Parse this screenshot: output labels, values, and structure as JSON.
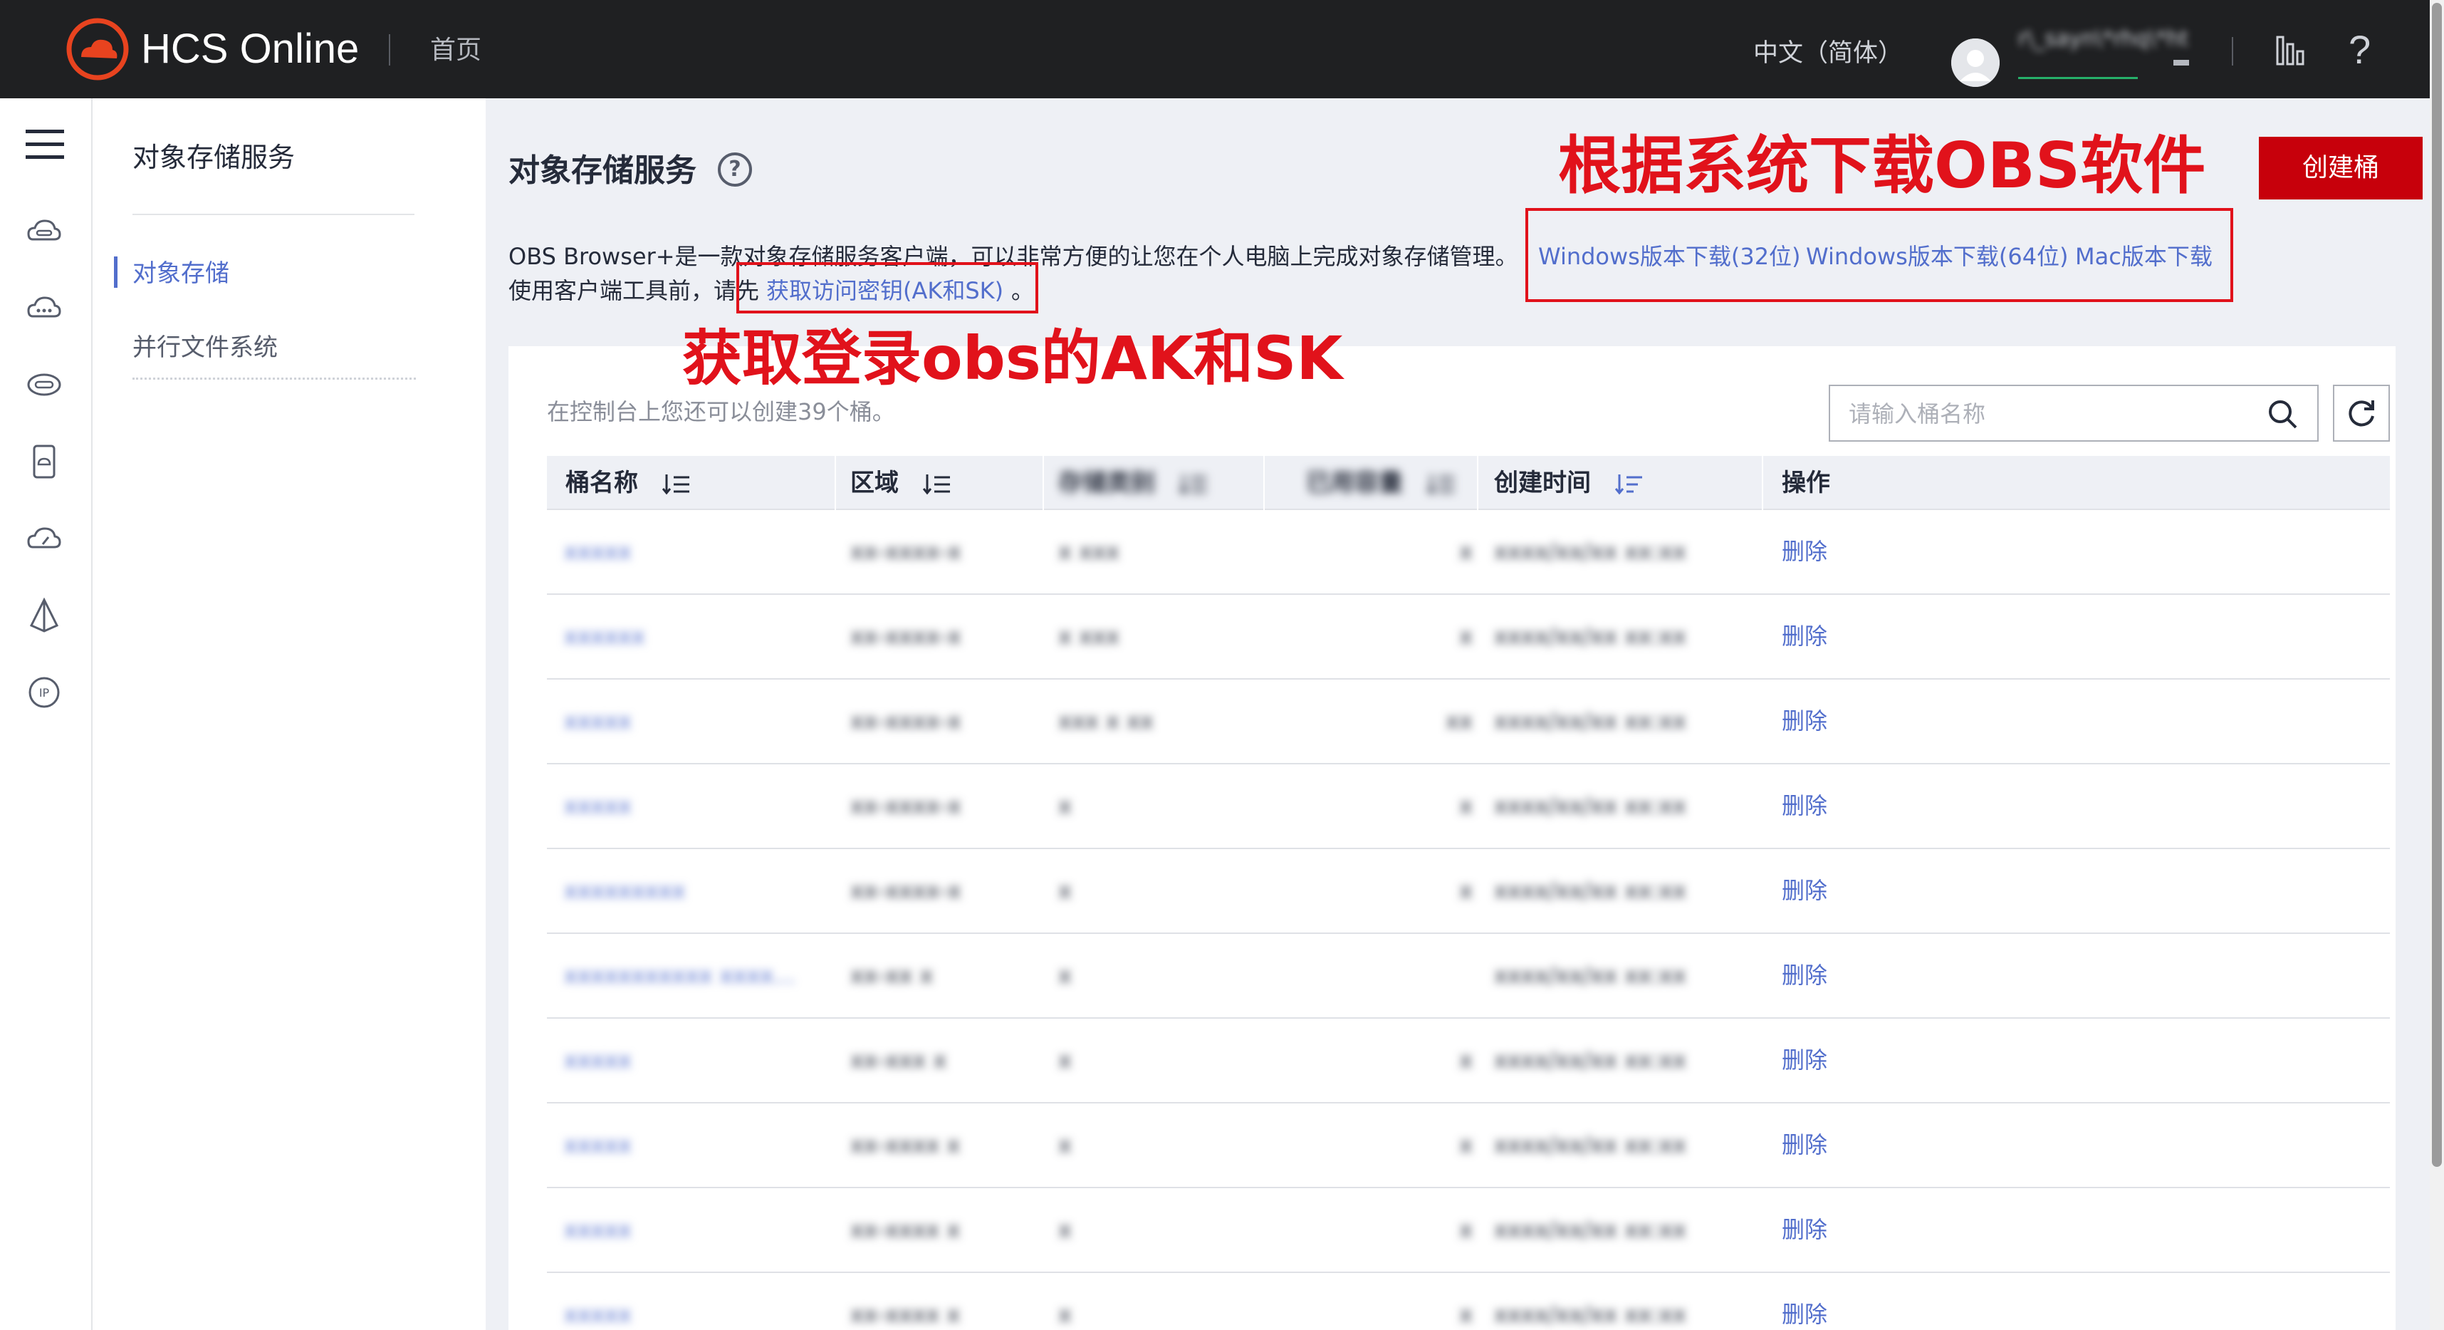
{
  "header": {
    "brand": "HCS Online",
    "home": "首页",
    "language": "中文（简体）",
    "username": "r\\_sayn\\*rhq\\*ht",
    "logo_color": "#e8431f"
  },
  "rail": {
    "icons": [
      "menu-icon",
      "obs-cloud-icon",
      "cloud-chat-icon",
      "storage-icon",
      "device-icon",
      "cloud-speed-icon",
      "pyramid-icon",
      "ip-icon"
    ]
  },
  "sidenav": {
    "title": "对象存储服务",
    "items": [
      {
        "label": "对象存储",
        "active": true
      },
      {
        "label": "并行文件系统",
        "active": false
      }
    ]
  },
  "main": {
    "title": "对象存储服务",
    "create_button": "创建桶",
    "desc_line1": "OBS Browser+是一款对象存储服务客户端，可以非常方便的让您在个人电脑上完成对象存储管理。",
    "desc_line2_prefix": "使用客户端工具前，请先",
    "desc_line2_suffix": "。",
    "links": {
      "win32": "Windows版本下载(32位)",
      "win64": "Windows版本下载(64位)",
      "mac": "Mac版本下载",
      "ak_sk": "获取访问密钥(AK和SK)"
    },
    "quota_text": "在控制台上您还可以创建39个桶。",
    "search_placeholder": "请输入桶名称"
  },
  "annotations": {
    "download": "根据系统下载OBS软件",
    "aksk": "获取登录obs的AK和SK",
    "color": "#e1121b"
  },
  "table": {
    "headers": {
      "name": "桶名称",
      "region": "区域",
      "storage_class": "存储类别",
      "size": "已用容量",
      "created": "创建时间",
      "actions": "操作"
    },
    "rows": [
      {
        "name": "xxxxx",
        "region": "xx-xxxx-x",
        "class": "x xxx",
        "size": "x",
        "created": "xxxx/xx/xx xx:xx",
        "action": "删除"
      },
      {
        "name": "xxxxxx",
        "region": "xx-xxxx-x",
        "class": "x xxx",
        "size": "x",
        "created": "xxxx/xx/xx xx:xx",
        "action": "删除"
      },
      {
        "name": "xxxxx",
        "region": "xx-xxxx-x",
        "class": "xxx x xx",
        "size": "xx",
        "created": "xxxx/xx/xx xx:xx",
        "action": "删除"
      },
      {
        "name": "xxxxx",
        "region": "xx-xxxx-x",
        "class": "x",
        "size": "x",
        "created": "xxxx/xx/xx xx:xx",
        "action": "删除"
      },
      {
        "name": "xxxxxxxxx",
        "region": "xx-xxxx-x",
        "class": "x",
        "size": "x",
        "created": "xxxx/xx/xx xx:xx",
        "action": "删除"
      },
      {
        "name": "xxxxxxxxxxx xxxx...",
        "region": "xx-xx x",
        "class": "x",
        "size": "",
        "created": "xxxx/xx/xx xx:xx",
        "action": "删除"
      },
      {
        "name": "xxxxx",
        "region": "xx-xxx x",
        "class": "x",
        "size": "x",
        "created": "xxxx/xx/xx xx:xx",
        "action": "删除"
      },
      {
        "name": "xxxxx",
        "region": "xx-xxxx x",
        "class": "x",
        "size": "x",
        "created": "xxxx/xx/xx xx:xx",
        "action": "删除"
      },
      {
        "name": "xxxxx",
        "region": "xx-xxxx x",
        "class": "x",
        "size": "x",
        "created": "xxxx/xx/xx xx:xx",
        "action": "删除"
      },
      {
        "name": "xxxxx",
        "region": "xx-xxxx x",
        "class": "x",
        "size": "x",
        "created": "xxxx/xx/xx xx:xx",
        "action": "删除"
      }
    ]
  }
}
